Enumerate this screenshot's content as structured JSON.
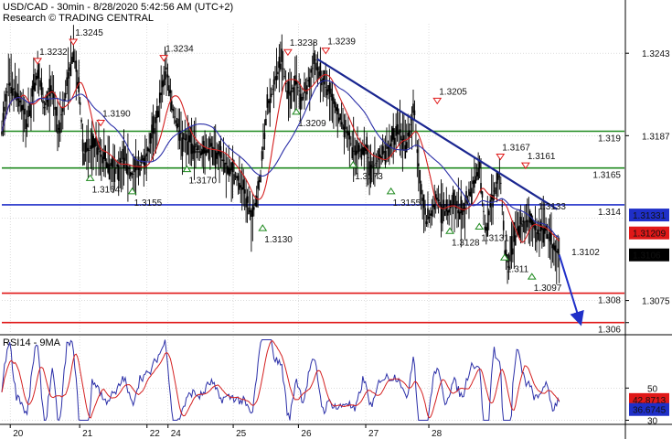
{
  "header": {
    "line1": "USD/CAD - 30min - 8/28/2020 5:42:56 AM (UTC+2)",
    "line2": "Research © TRADING CENTRAL"
  },
  "rsi_label": "RSI14 - 9MA",
  "colors": {
    "price": "#000000",
    "ma_fast": "#d42020",
    "ma_slow": "#2b2fa8",
    "support_green": "#1f8a1f",
    "pivot_blue": "#1f2fc8",
    "target_red": "#e01818",
    "trend": "#1a2690",
    "grid": "#c8c8c8"
  },
  "chart_data": {
    "type": "line",
    "instrument": "USD/CAD",
    "timeframe": "30min",
    "x_ticks": [
      "20",
      "21",
      "22",
      "24",
      "25",
      "26",
      "27",
      "28"
    ],
    "y_ticks": [
      "1.3243",
      "1.3187",
      "1.3075",
      "1.306"
    ],
    "ylim": [
      1.3053,
      1.3263
    ],
    "price_path": [
      [
        0,
        1.319
      ],
      [
        0.15,
        1.3222
      ],
      [
        0.4,
        1.3215
      ],
      [
        0.6,
        1.3195
      ],
      [
        0.85,
        1.3232
      ],
      [
        1.0,
        1.3205
      ],
      [
        1.2,
        1.3218
      ],
      [
        1.35,
        1.319
      ],
      [
        1.7,
        1.3245
      ],
      [
        1.85,
        1.3212
      ],
      [
        1.95,
        1.3175
      ],
      [
        2.25,
        1.318
      ],
      [
        2.45,
        1.317
      ],
      [
        2.7,
        1.3164
      ],
      [
        2.9,
        1.3172
      ],
      [
        3.1,
        1.316
      ],
      [
        3.3,
        1.3168
      ],
      [
        3.5,
        1.3178
      ],
      [
        3.7,
        1.32
      ],
      [
        3.9,
        1.3234
      ],
      [
        4.1,
        1.32
      ],
      [
        4.3,
        1.3185
      ],
      [
        4.5,
        1.3182
      ],
      [
        4.75,
        1.3175
      ],
      [
        5.0,
        1.318
      ],
      [
        5.2,
        1.3172
      ],
      [
        5.5,
        1.3162
      ],
      [
        5.75,
        1.315
      ],
      [
        5.95,
        1.313
      ],
      [
        6.15,
        1.316
      ],
      [
        6.3,
        1.3205
      ],
      [
        6.5,
        1.3225
      ],
      [
        6.65,
        1.3238
      ],
      [
        6.8,
        1.3215
      ],
      [
        7.0,
        1.3222
      ],
      [
        7.15,
        1.3212
      ],
      [
        7.3,
        1.3225
      ],
      [
        7.45,
        1.3239
      ],
      [
        7.6,
        1.3225
      ],
      [
        7.8,
        1.3215
      ],
      [
        8.0,
        1.32
      ],
      [
        8.2,
        1.319
      ],
      [
        8.4,
        1.3173
      ],
      [
        8.6,
        1.318
      ],
      [
        8.8,
        1.3165
      ],
      [
        9.0,
        1.3172
      ],
      [
        9.2,
        1.318
      ],
      [
        9.45,
        1.319
      ],
      [
        9.6,
        1.318
      ],
      [
        9.8,
        1.3205
      ],
      [
        9.95,
        1.315
      ],
      [
        10.1,
        1.3128
      ],
      [
        10.35,
        1.3145
      ],
      [
        10.55,
        1.3135
      ],
      [
        10.75,
        1.314
      ],
      [
        10.95,
        1.3133
      ],
      [
        11.15,
        1.315
      ],
      [
        11.35,
        1.3167
      ],
      [
        11.5,
        1.312
      ],
      [
        11.65,
        1.3145
      ],
      [
        11.85,
        1.3161
      ],
      [
        11.95,
        1.311
      ],
      [
        12.05,
        1.3097
      ],
      [
        12.25,
        1.3125
      ],
      [
        12.5,
        1.313
      ],
      [
        12.75,
        1.312
      ],
      [
        12.9,
        1.3125
      ],
      [
        13.1,
        1.311
      ],
      [
        13.25,
        1.3106
      ]
    ],
    "horizontal_levels": [
      {
        "label": "1.319",
        "value": 1.319,
        "color": "green"
      },
      {
        "label": "1.3165",
        "value": 1.3165,
        "color": "green"
      },
      {
        "label": "1.314",
        "value": 1.314,
        "color": "blue"
      },
      {
        "label": "1.308",
        "value": 1.308,
        "color": "red"
      },
      {
        "label": "1.306",
        "value": 1.306,
        "color": "red"
      }
    ],
    "price_tags": [
      {
        "label": "1.31331",
        "value": 1.31331,
        "style": "blue"
      },
      {
        "label": "1.31209",
        "value": 1.31209,
        "style": "red"
      },
      {
        "label": "1.3106",
        "value": 1.3106,
        "style": "black"
      }
    ],
    "trendline": [
      [
        7.5,
        1.3239
      ],
      [
        13.2,
        1.3137
      ]
    ],
    "arrows": [
      {
        "from": [
          13.25,
          1.3106
        ],
        "to": [
          13.75,
          1.306
        ],
        "type": "projection"
      },
      {
        "from": [
          4.5,
          1.3176
        ],
        "to": [
          4.85,
          1.3176
        ],
        "type": "marker"
      }
    ],
    "annotations": [
      {
        "label": "1.3232",
        "x": 0.85,
        "y": 1.3232,
        "dir": "down"
      },
      {
        "label": "1.3245",
        "x": 1.7,
        "y": 1.3245,
        "dir": "down"
      },
      {
        "label": "1.3190",
        "x": 2.35,
        "y": 1.319,
        "dir": "down"
      },
      {
        "label": "1.3164",
        "x": 2.1,
        "y": 1.3164,
        "dir": "up"
      },
      {
        "label": "1.3155",
        "x": 3.1,
        "y": 1.3155,
        "dir": "up"
      },
      {
        "label": "1.3234",
        "x": 3.85,
        "y": 1.3234,
        "dir": "down"
      },
      {
        "label": "1.3170",
        "x": 4.4,
        "y": 1.317,
        "dir": "up"
      },
      {
        "label": "1.3130",
        "x": 6.2,
        "y": 1.313,
        "dir": "up"
      },
      {
        "label": "1.3238",
        "x": 6.8,
        "y": 1.3238,
        "dir": "down"
      },
      {
        "label": "1.3239",
        "x": 7.7,
        "y": 1.3239,
        "dir": "down"
      },
      {
        "label": "1.3209",
        "x": 7.0,
        "y": 1.3209,
        "dir": "up"
      },
      {
        "label": "1.3173",
        "x": 8.35,
        "y": 1.3173,
        "dir": "up"
      },
      {
        "label": "1.3155",
        "x": 9.25,
        "y": 1.3155,
        "dir": "up"
      },
      {
        "label": "1.3205",
        "x": 10.35,
        "y": 1.3205,
        "dir": "down"
      },
      {
        "label": "1.3128",
        "x": 10.65,
        "y": 1.3128,
        "dir": "up"
      },
      {
        "label": "1.3167",
        "x": 11.85,
        "y": 1.3167,
        "dir": "down"
      },
      {
        "label": "1.3161",
        "x": 12.45,
        "y": 1.3161,
        "dir": "down"
      },
      {
        "label": "1.3133",
        "x": 12.7,
        "y": 1.3133,
        "dir": "none"
      },
      {
        "label": "1.3131",
        "x": 11.35,
        "y": 1.3131,
        "dir": "up"
      },
      {
        "label": "1.311",
        "x": 11.95,
        "y": 1.311,
        "dir": "up"
      },
      {
        "label": "1.3097",
        "x": 12.6,
        "y": 1.3097,
        "dir": "up"
      },
      {
        "label": "1.3102",
        "x": 13.5,
        "y": 1.3102,
        "dir": "none"
      }
    ],
    "rsi_panel": {
      "y_ticks": [
        "50",
        "30"
      ],
      "ylim": [
        28,
        82
      ],
      "tags": [
        {
          "label": "42.8713",
          "value": 42.8713,
          "style": "red"
        },
        {
          "label": "36.6745",
          "value": 36.6745,
          "style": "blue"
        }
      ]
    }
  }
}
